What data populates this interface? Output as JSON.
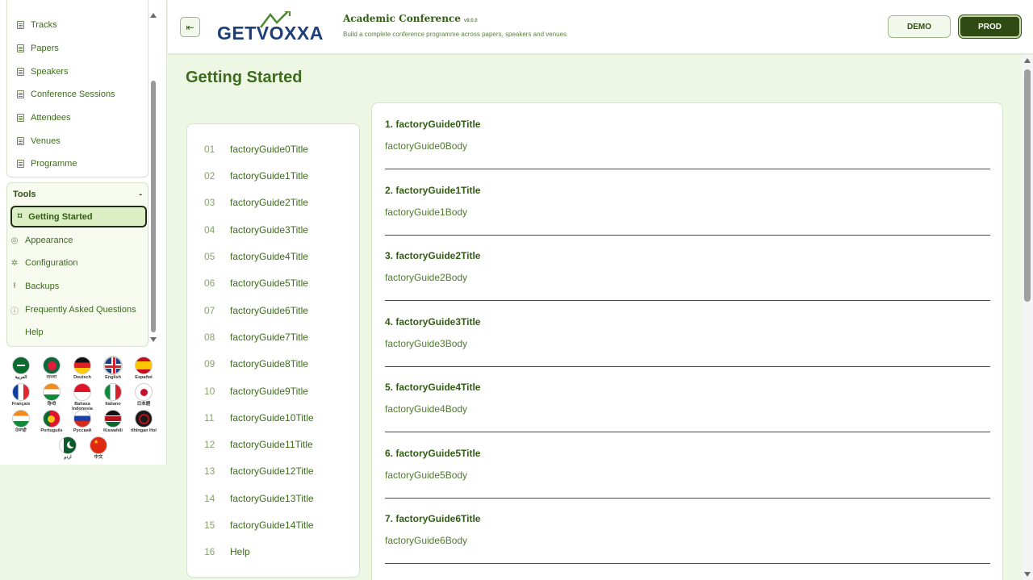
{
  "sidebar": {
    "nav_items": [
      {
        "label": "Tracks",
        "icon": "document-icon"
      },
      {
        "label": "Papers",
        "icon": "document-icon"
      },
      {
        "label": "Speakers",
        "icon": "document-icon"
      },
      {
        "label": "Conference Sessions",
        "icon": "document-icon"
      },
      {
        "label": "Attendees",
        "icon": "document-icon"
      },
      {
        "label": "Venues",
        "icon": "document-icon"
      },
      {
        "label": "Programme",
        "icon": "document-icon"
      }
    ],
    "tools": {
      "header": "Tools",
      "collapse_symbol": "-",
      "items": [
        {
          "label": "Getting Started",
          "icon": "book-open-icon",
          "glyph": "⌑",
          "active": true
        },
        {
          "label": "Appearance",
          "icon": "palette-icon",
          "glyph": "◎"
        },
        {
          "label": "Configuration",
          "icon": "gear-icon",
          "glyph": "✲"
        },
        {
          "label": "Backups",
          "icon": "upload-icon",
          "glyph": "⭱"
        },
        {
          "label": "Frequently Asked Questions",
          "icon": "question-icon",
          "glyph": "ⓘ"
        },
        {
          "label": "Help",
          "icon": "",
          "glyph": ""
        }
      ]
    },
    "languages": [
      {
        "label": "العربية",
        "flag": "saudi-arabia-flag"
      },
      {
        "label": "বাংলা",
        "flag": "bangladesh-flag"
      },
      {
        "label": "Deutsch",
        "flag": "germany-flag"
      },
      {
        "label": "English",
        "flag": "uk-flag",
        "selected": true
      },
      {
        "label": "Español",
        "flag": "spain-flag"
      },
      {
        "label": "Français",
        "flag": "france-flag"
      },
      {
        "label": "हिन्दी",
        "flag": "india-flag"
      },
      {
        "label": "Bahasa Indonesia",
        "flag": "indonesia-flag"
      },
      {
        "label": "Italiano",
        "flag": "italy-flag"
      },
      {
        "label": "日本語",
        "flag": "japan-flag"
      },
      {
        "label": "ਪੰਜਾਬੀ",
        "flag": "india-flag"
      },
      {
        "label": "Português",
        "flag": "portugal-flag"
      },
      {
        "label": "Русский",
        "flag": "russia-flag"
      },
      {
        "label": "Kiswahili",
        "flag": "kenya-flag"
      },
      {
        "label": "tlhIngan Hol",
        "flag": "klingon-flag"
      },
      {
        "label": "اردو",
        "flag": "pakistan-flag"
      },
      {
        "label": "中文",
        "flag": "china-flag"
      }
    ]
  },
  "header": {
    "logo_text": "GETVOXXA",
    "app_title": "Academic Conference",
    "app_version": "v9.0.0",
    "app_subtitle": "Build a complete conference programme across papers, speakers and venues",
    "demo_label": "DEMO",
    "prod_label": "PROD"
  },
  "main": {
    "page_title": "Getting Started",
    "toc": [
      {
        "num": "01",
        "label": "factoryGuide0Title"
      },
      {
        "num": "02",
        "label": "factoryGuide1Title"
      },
      {
        "num": "03",
        "label": "factoryGuide2Title"
      },
      {
        "num": "04",
        "label": "factoryGuide3Title"
      },
      {
        "num": "05",
        "label": "factoryGuide4Title"
      },
      {
        "num": "06",
        "label": "factoryGuide5Title"
      },
      {
        "num": "07",
        "label": "factoryGuide6Title"
      },
      {
        "num": "08",
        "label": "factoryGuide7Title"
      },
      {
        "num": "09",
        "label": "factoryGuide8Title"
      },
      {
        "num": "10",
        "label": "factoryGuide9Title"
      },
      {
        "num": "11",
        "label": "factoryGuide10Title"
      },
      {
        "num": "12",
        "label": "factoryGuide11Title"
      },
      {
        "num": "13",
        "label": "factoryGuide12Title"
      },
      {
        "num": "14",
        "label": "factoryGuide13Title"
      },
      {
        "num": "15",
        "label": "factoryGuide14Title"
      },
      {
        "num": "16",
        "label": "Help"
      }
    ],
    "guides": [
      {
        "title": "1. factoryGuide0Title",
        "body": "factoryGuide0Body"
      },
      {
        "title": "2. factoryGuide1Title",
        "body": "factoryGuide1Body"
      },
      {
        "title": "3. factoryGuide2Title",
        "body": "factoryGuide2Body"
      },
      {
        "title": "4. factoryGuide3Title",
        "body": "factoryGuide3Body"
      },
      {
        "title": "5. factoryGuide4Title",
        "body": "factoryGuide4Body"
      },
      {
        "title": "6. factoryGuide5Title",
        "body": "factoryGuide5Body"
      },
      {
        "title": "7. factoryGuide6Title",
        "body": "factoryGuide6Body"
      }
    ]
  },
  "colors": {
    "accent": "#2f5d12",
    "background": "#eef6e4",
    "active_button": "#2f4a12",
    "logo_blue": "#1e3f7a"
  }
}
